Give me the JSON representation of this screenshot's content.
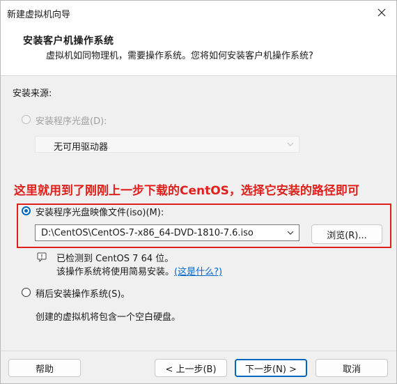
{
  "window": {
    "title": "新建虚拟机向导",
    "close_icon": "close-icon"
  },
  "header": {
    "title": "安装客户机操作系统",
    "subtitle": "虚拟机如同物理机，需要操作系统。您将如何安装客户机操作系统?"
  },
  "install_source_label": "安装来源:",
  "option_disc": {
    "label": "安装程序光盘(D):",
    "selected": false,
    "enabled": false
  },
  "drive_select": {
    "value": "无可用驱动器",
    "enabled": false
  },
  "annotation": {
    "text": "这里就用到了刚刚上一步下载的CentOS，选择它安装的路径即可",
    "color": "#e0201c"
  },
  "option_iso": {
    "label": "安装程序光盘映像文件(iso)(M):",
    "selected": true
  },
  "iso_path": {
    "value": "D:\\CentOS\\CentOS-7-x86_64-DVD-1810-7.6.iso"
  },
  "browse_button": "浏览(R)...",
  "detection": {
    "line1": "已检测到 CentOS 7 64 位。",
    "line2_prefix": "该操作系统将使用简易安装。",
    "link": "(这是什么?)"
  },
  "option_later": {
    "label": "稍后安装操作系统(S)。",
    "selected": false
  },
  "later_desc": "创建的虚拟机将包含一个空白硬盘。",
  "footer": {
    "help": "帮助",
    "back": "< 上一步(B)",
    "next": "下一步(N) >",
    "cancel": "取消"
  },
  "colors": {
    "accent": "#0067c0",
    "annotation_red": "#e0201c",
    "link": "#0066cc"
  }
}
